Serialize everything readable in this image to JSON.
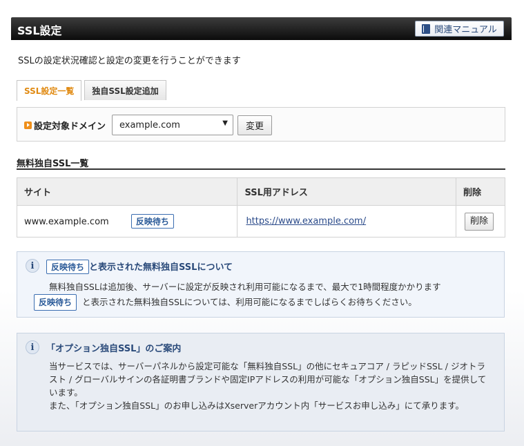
{
  "header": {
    "title": "SSL設定",
    "manual_label": "関連マニュアル"
  },
  "intro": "SSLの設定状況確認と設定の変更を行うことができます",
  "tabs": [
    {
      "label": "SSL設定一覧",
      "active": true
    },
    {
      "label": "独自SSL設定追加",
      "active": false
    }
  ],
  "domain_selector": {
    "label": "設定対象ドメイン",
    "value": "example.com",
    "button_label": "変更"
  },
  "list": {
    "title": "無料独自SSL一覧",
    "columns": [
      "サイト",
      "SSL用アドレス",
      "削除"
    ],
    "rows": [
      {
        "site": "www.example.com",
        "status": "反映待ち",
        "address": "https://www.example.com/",
        "delete_label": "削除"
      }
    ]
  },
  "notice1": {
    "badge": "反映待ち",
    "title_suffix": "と表示された無料独自SSLについて",
    "line1": "無料独自SSLは追加後、サーバーに設定が反映され利用可能になるまで、最大で1時間程度かかります",
    "line2_badge": "反映待ち",
    "line2_text": "と表示された無料独自SSLについては、利用可能になるまでしばらくお待ちください。"
  },
  "notice2": {
    "title": "「オプション独自SSL」のご案内",
    "paragraph1": "当サービスでは、サーバーパネルから設定可能な「無料独自SSL」の他にセキュアコア / ラピッドSSL / ジオトラスト / グローバルサインの各証明書ブランドや固定IPアドレスの利用が可能な「オプション独自SSL」を提供しています。",
    "paragraph2": "また、「オプション独自SSL」のお申し込みはXserverアカウント内「サービスお申し込み」にて承ります。"
  },
  "icons": {
    "manual": "book-icon",
    "domain": "arrow-right-icon",
    "info": "info-icon",
    "select": "caret-down-icon"
  },
  "colors": {
    "header_bg": "#111111",
    "active_tab": "#e08a12",
    "badge_border": "#3a6db0",
    "link": "#2a4a8a",
    "notice_title": "#2a4a7a"
  }
}
